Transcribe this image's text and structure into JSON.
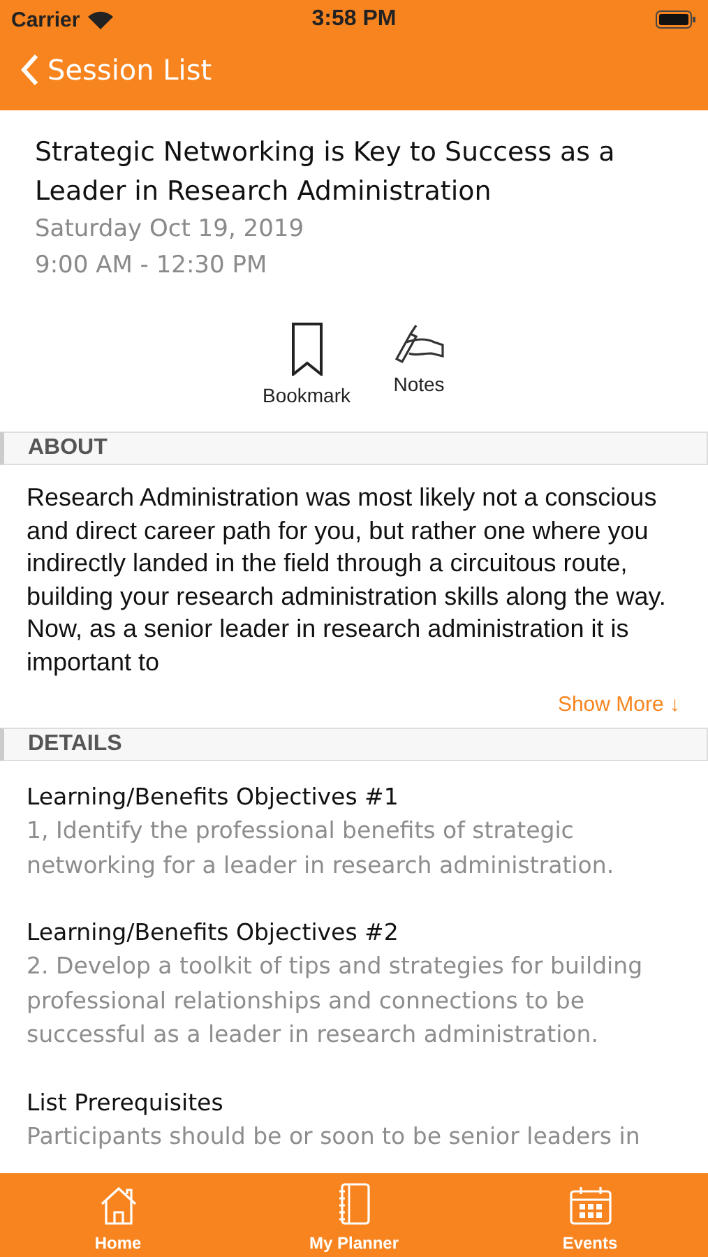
{
  "status_bar": {
    "carrier": "Carrier",
    "time": "3:58 PM"
  },
  "nav": {
    "back_label": "Session List"
  },
  "session": {
    "title": "Strategic Networking is Key to Success as a Leader in Research Administration",
    "date": "Saturday Oct 19, 2019",
    "time": "9:00 AM - 12:30 PM"
  },
  "actions": [
    {
      "kind": "bookmark",
      "label": "Bookmark"
    },
    {
      "kind": "notes",
      "label": "Notes"
    }
  ],
  "about": {
    "header": "ABOUT",
    "text": "Research Administration was most likely not a conscious and direct career path for you, but rather one where you indirectly landed in the field through a circuitous route, building your research administration skills along the way. Now, as a senior leader in research administration it is important to",
    "show_more": "Show More ↓"
  },
  "details": {
    "header": "DETAILS",
    "items": [
      {
        "label": "Learning/Benefits Objectives #1",
        "value": "1, Identify the professional benefits of strategic networking for a leader in research administration."
      },
      {
        "label": "Learning/Benefits Objectives #2",
        "value": "2. Develop a toolkit of tips and strategies for building professional relationships and connections to be successful as a leader in research administration."
      },
      {
        "label": "List Prerequisites",
        "value": "Participants should be or soon to be senior leaders in"
      }
    ]
  },
  "tab_bar": [
    {
      "kind": "home",
      "label": "Home"
    },
    {
      "kind": "planner",
      "label": "My Planner"
    },
    {
      "kind": "events",
      "label": "Events"
    }
  ]
}
